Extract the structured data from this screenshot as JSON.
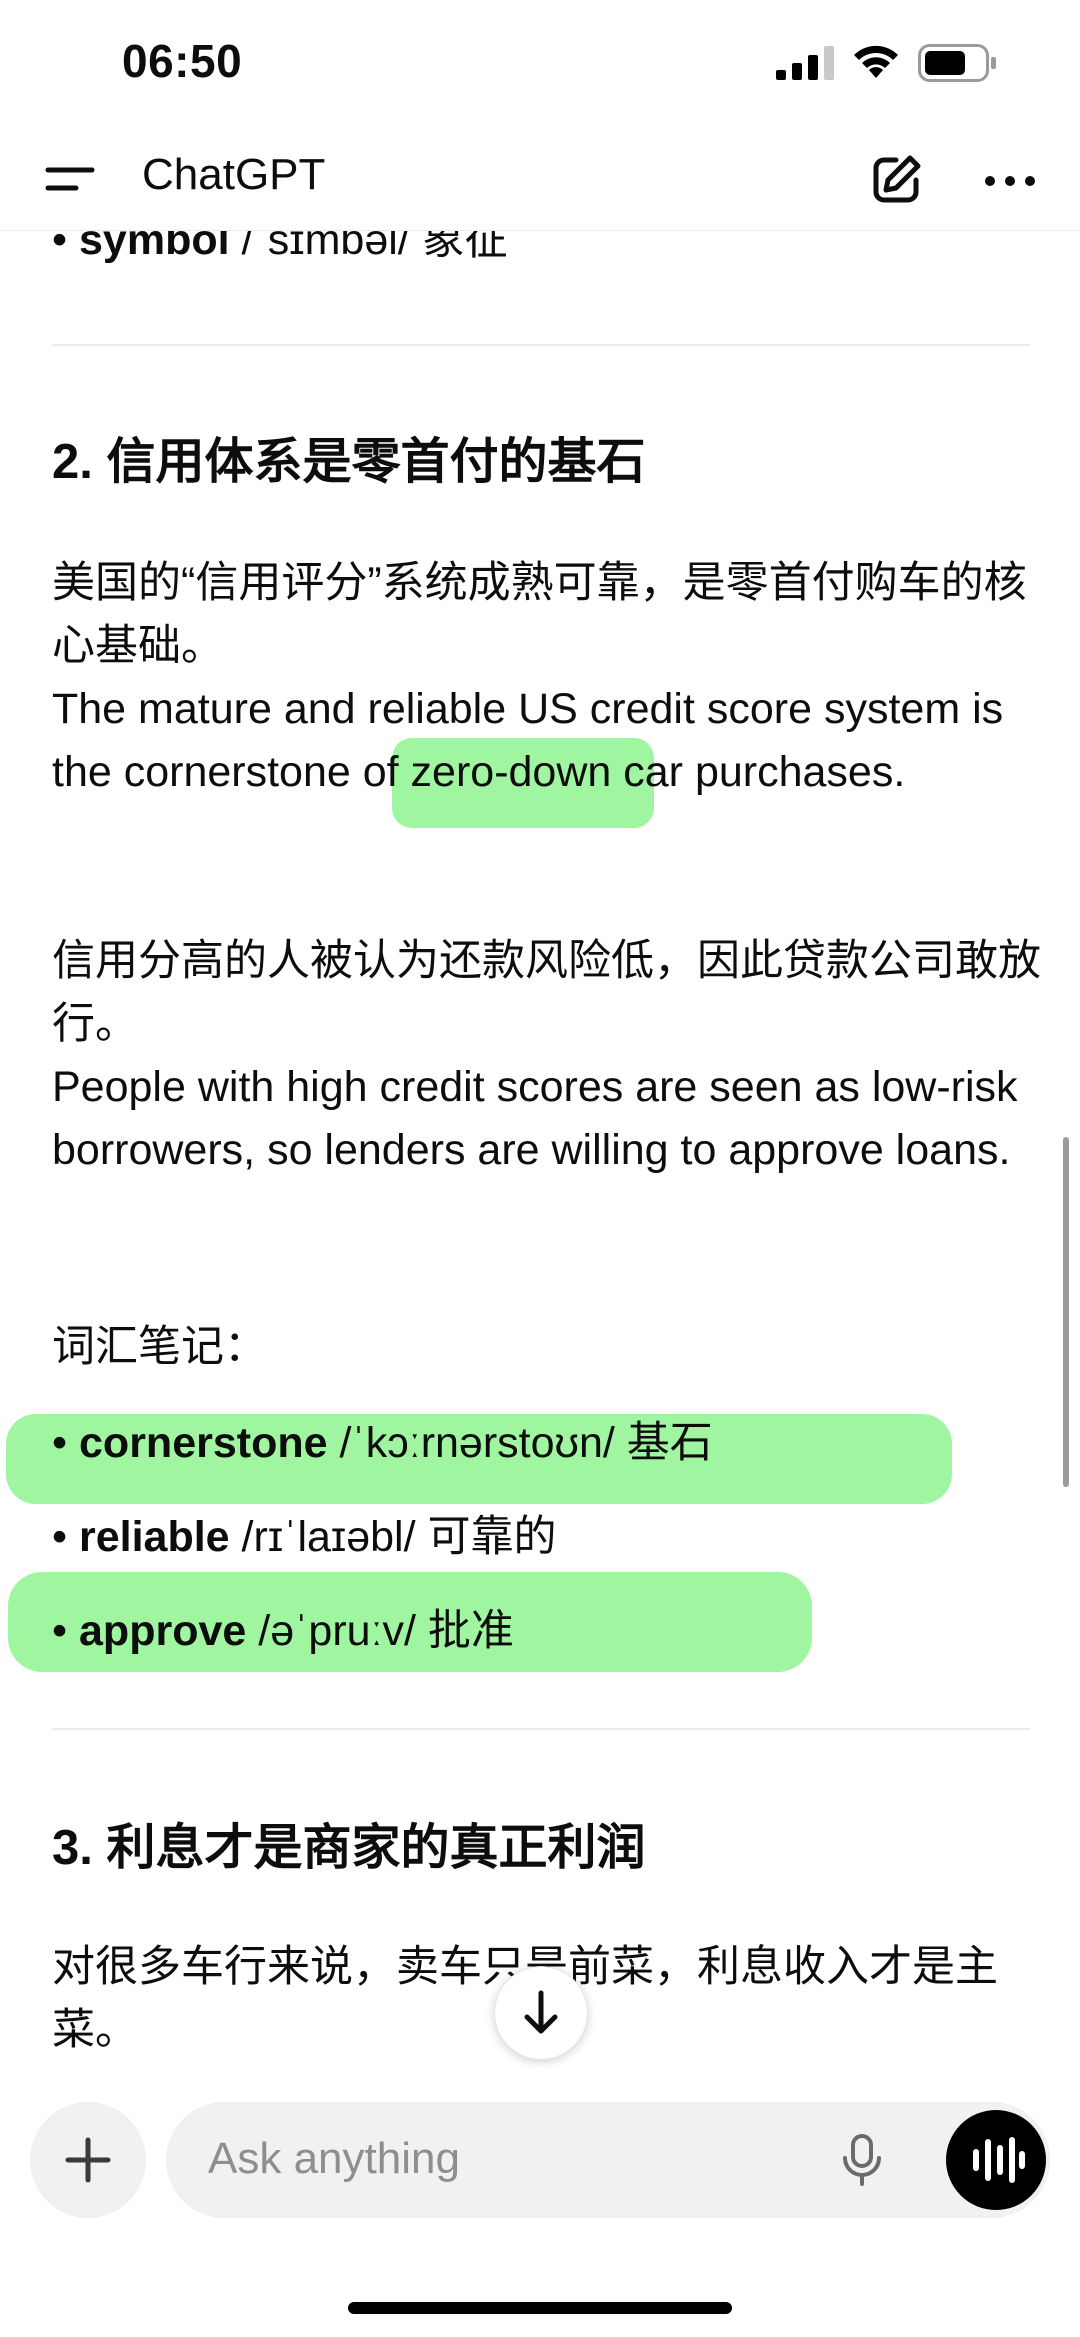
{
  "status_bar": {
    "time": "06:50"
  },
  "header": {
    "title": "ChatGPT"
  },
  "content": {
    "cut_line": {
      "word": "symbol",
      "rest": " /ˈsɪmbəl/ 象征"
    },
    "section2": {
      "heading": "2. 信用体系是零首付的基石",
      "para1_zh": "美国的“信用评分”系统成熟可靠，是零首付购车的核心基础。",
      "para1_en": "The mature and reliable US credit score system is the cornerstone of zero-down car purchases.",
      "para2_zh": "信用分高的人被认为还款风险低，因此贷款公司敢放行。",
      "para2_en": "People with high credit scores are seen as low-risk borrowers, so lenders are willing to approve loans.",
      "vocab_title": "词汇笔记：",
      "vocab": [
        {
          "word": "cornerstone",
          "rest": " /ˈkɔːrnərstoʊn/ 基石"
        },
        {
          "word": "reliable",
          "rest": " /rɪˈlaɪəbl/ 可靠的"
        },
        {
          "word": "approve",
          "rest": " /əˈpruːv/ 批准"
        }
      ]
    },
    "section3": {
      "heading": "3. 利息才是商家的真正利润",
      "para1_zh": "对很多车行来说，卖车只是前菜，利息收入才是主菜。"
    }
  },
  "input": {
    "placeholder": "Ask anything"
  }
}
